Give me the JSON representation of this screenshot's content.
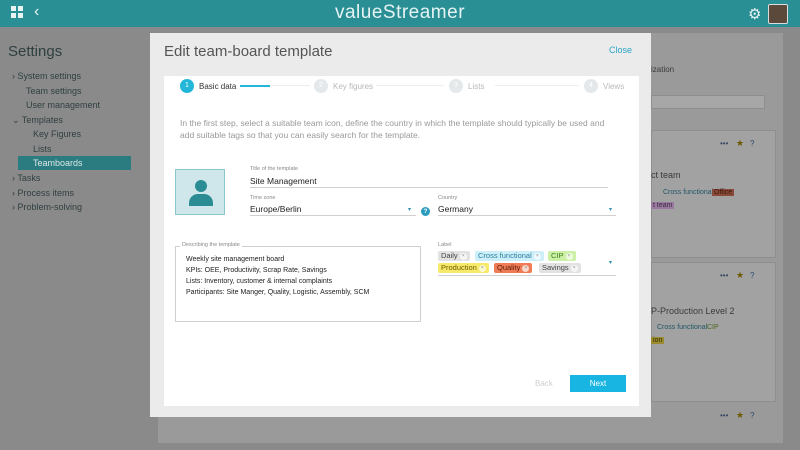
{
  "app": {
    "logo": "valueStreamer"
  },
  "background": {
    "sidebar": {
      "title": "Settings",
      "items": [
        {
          "label": "System settings",
          "chevron": "›"
        },
        {
          "label": "Team settings"
        },
        {
          "label": "User management"
        },
        {
          "label": "Templates",
          "chevron": "⌄"
        },
        {
          "label": "Key Figures"
        },
        {
          "label": "Lists"
        },
        {
          "label": "Teamboards"
        },
        {
          "label": "Tasks",
          "chevron": "›"
        },
        {
          "label": "Process items",
          "chevron": "›"
        },
        {
          "label": "Problem-solving",
          "chevron": "›"
        }
      ]
    },
    "main": {
      "frag_org": "ization",
      "card1": {
        "title": "ct team",
        "tag1": "Cross functional",
        "tag2": "Office",
        "tag3": "t team"
      },
      "card2": {
        "title": "P-Production Level 2",
        "tag1": "Cross functional",
        "tag2": "CIP",
        "tag3": "ion"
      },
      "icons": {
        "more": "•••",
        "star": "★",
        "help": "?"
      }
    }
  },
  "modal": {
    "title": "Edit team-board template",
    "close_label": "Close",
    "steps": [
      {
        "num": "1",
        "label": "Basic data"
      },
      {
        "num": "2",
        "label": "Key figures"
      },
      {
        "num": "3",
        "label": "Lists"
      },
      {
        "num": "4",
        "label": "Views"
      }
    ],
    "intro": "In the first step, select a suitable team icon, define the country in which the template should typically be used and add suitable tags so that you can easily search for the template.",
    "form": {
      "title_label": "Title of the template",
      "title_value": "Site Management",
      "timezone_label": "Time zone",
      "timezone_value": "Europe/Berlin",
      "country_label": "Country",
      "country_value": "Germany",
      "help_glyph": "?",
      "description_label": "Describing the template",
      "description_lines": [
        "Weekly site management board",
        "KPIs: OEE, Productivity, Scrap Rate, Savings",
        "Lists: Inventory, customer & internal complaints",
        "Participants: Site Manger, Quality, Logistic, Assembly, SCM"
      ],
      "label_label": "Label",
      "tags": [
        {
          "text": "Daily",
          "color": "#e2e2e2",
          "fg": "#444"
        },
        {
          "text": "Cross functional",
          "color": "#cdeffa",
          "fg": "#2a7f9b"
        },
        {
          "text": "CIP",
          "color": "#ccf0a5",
          "fg": "#3e7d1c"
        },
        {
          "text": "Production",
          "color": "#f7e96a",
          "fg": "#6b5c00"
        },
        {
          "text": "Quality",
          "color": "#ef7c56",
          "fg": "#5c1d08"
        },
        {
          "text": "Savings",
          "color": "#e2e2e2",
          "fg": "#444"
        }
      ],
      "remove_glyph": "×",
      "caret": "▾"
    },
    "buttons": {
      "back": "Back",
      "next": "Next"
    }
  },
  "colors": {
    "topbar": "#2a8f94",
    "accent": "#18b5e2",
    "link": "#2aa4c4"
  }
}
